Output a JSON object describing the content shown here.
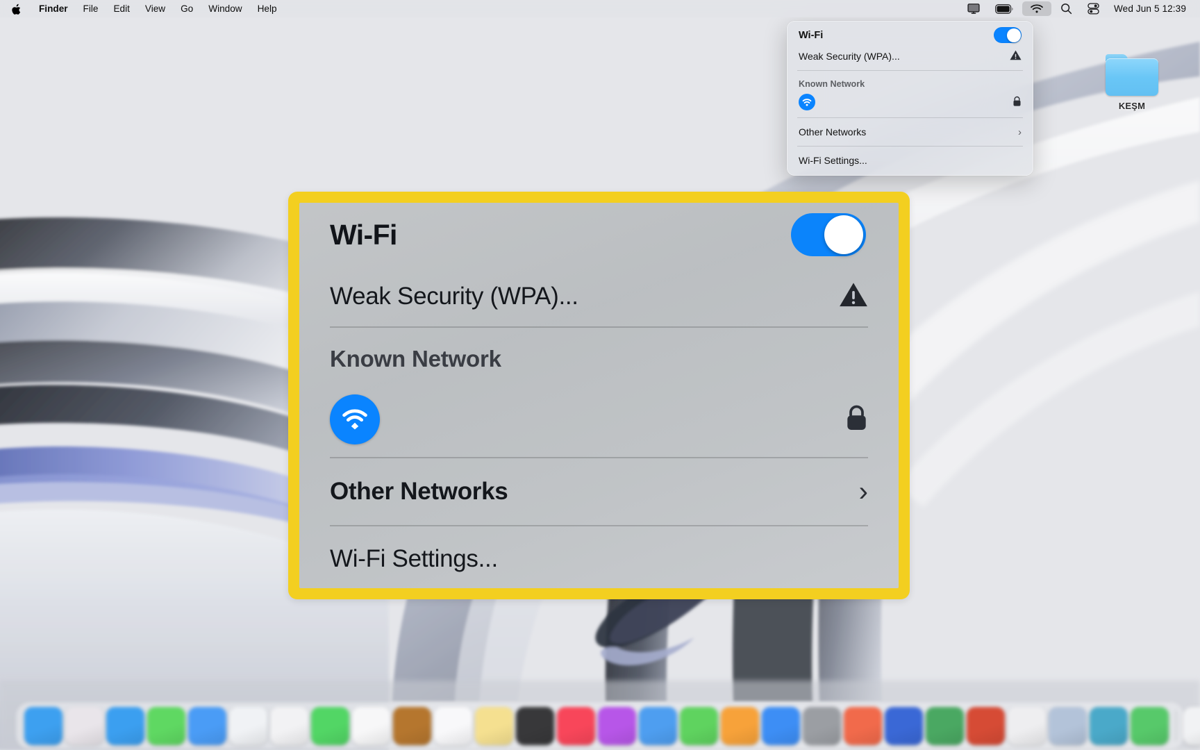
{
  "menubar": {
    "apple_icon": "apple-logo",
    "items": [
      "Finder",
      "File",
      "Edit",
      "View",
      "Go",
      "Window",
      "Help"
    ],
    "status_icons": [
      "screen-mirroring-icon",
      "battery-icon",
      "wifi-icon",
      "spotlight-search-icon",
      "control-center-icon"
    ],
    "clock": "Wed Jun 5  12:39"
  },
  "desktop": {
    "folder": {
      "name": "KEŞM",
      "icon": "folder-icon"
    }
  },
  "wifi_menu": {
    "title": "Wi-Fi",
    "toggle_state": "on",
    "weak_security": "Weak Security (WPA)...",
    "warning_icon": "warning-triangle-icon",
    "section_known": "Known Network",
    "network": {
      "name": "",
      "name_redacted": true,
      "wifi_icon": "wifi-signal-icon",
      "lock_icon": "lock-icon"
    },
    "other_networks": "Other Networks",
    "other_networks_chevron": "chevron-right-icon",
    "settings": "Wi-Fi Settings..."
  },
  "callout": {
    "border_color": "#f3cf20",
    "title": "Wi-Fi",
    "toggle_state": "on",
    "weak_security": "Weak Security (WPA)...",
    "warning_icon": "warning-triangle-icon",
    "section_known": "Known Network",
    "network": {
      "name": "",
      "name_redacted": true,
      "wifi_icon": "wifi-signal-icon",
      "lock_icon": "lock-icon"
    },
    "other_networks": "Other Networks",
    "other_networks_chevron": "chevron-right-icon",
    "settings": "Wi-Fi Settings..."
  },
  "dock": {
    "apps": [
      {
        "name": "finder",
        "color": "#3da0f0"
      },
      {
        "name": "launchpad",
        "color": "#e9e5ea"
      },
      {
        "name": "safari",
        "color": "#3b9ff0"
      },
      {
        "name": "messages",
        "color": "#5fd862"
      },
      {
        "name": "mail",
        "color": "#4a9cf6"
      },
      {
        "name": "photos",
        "color": "#f0f2f5"
      },
      {
        "name": "color-wheel-app",
        "color": "#f2f2f4"
      },
      {
        "name": "facetime",
        "color": "#52d665"
      },
      {
        "name": "calendar",
        "color": "#f7f7f8"
      },
      {
        "name": "contacts",
        "color": "#b5762e"
      },
      {
        "name": "reminders",
        "color": "#f8f8fa"
      },
      {
        "name": "notes",
        "color": "#f5e090"
      },
      {
        "name": "terminal",
        "color": "#38383a"
      },
      {
        "name": "music",
        "color": "#f8465a"
      },
      {
        "name": "podcasts",
        "color": "#b756e8"
      },
      {
        "name": "tv",
        "color": "#4e9ef0"
      },
      {
        "name": "whatsapp",
        "color": "#5fd35f"
      },
      {
        "name": "notes-alt",
        "color": "#f7a23a"
      },
      {
        "name": "app-store",
        "color": "#3d8ef5"
      },
      {
        "name": "system-settings",
        "color": "#9b9ea3"
      },
      {
        "name": "adobe-app",
        "color": "#f16a4b"
      },
      {
        "name": "word",
        "color": "#3a68d6"
      },
      {
        "name": "excel",
        "color": "#4aa862"
      },
      {
        "name": "powerpoint",
        "color": "#d64b35"
      },
      {
        "name": "chrome",
        "color": "#eeeef0"
      },
      {
        "name": "preview",
        "color": "#b3c3d9"
      },
      {
        "name": "maps",
        "color": "#4aa9c9"
      },
      {
        "name": "messages-alt",
        "color": "#57c96a"
      },
      {
        "name": "downloads-stack",
        "color": "#f1f2f4"
      },
      {
        "name": "trash",
        "color": "#dfe1e5"
      }
    ]
  }
}
